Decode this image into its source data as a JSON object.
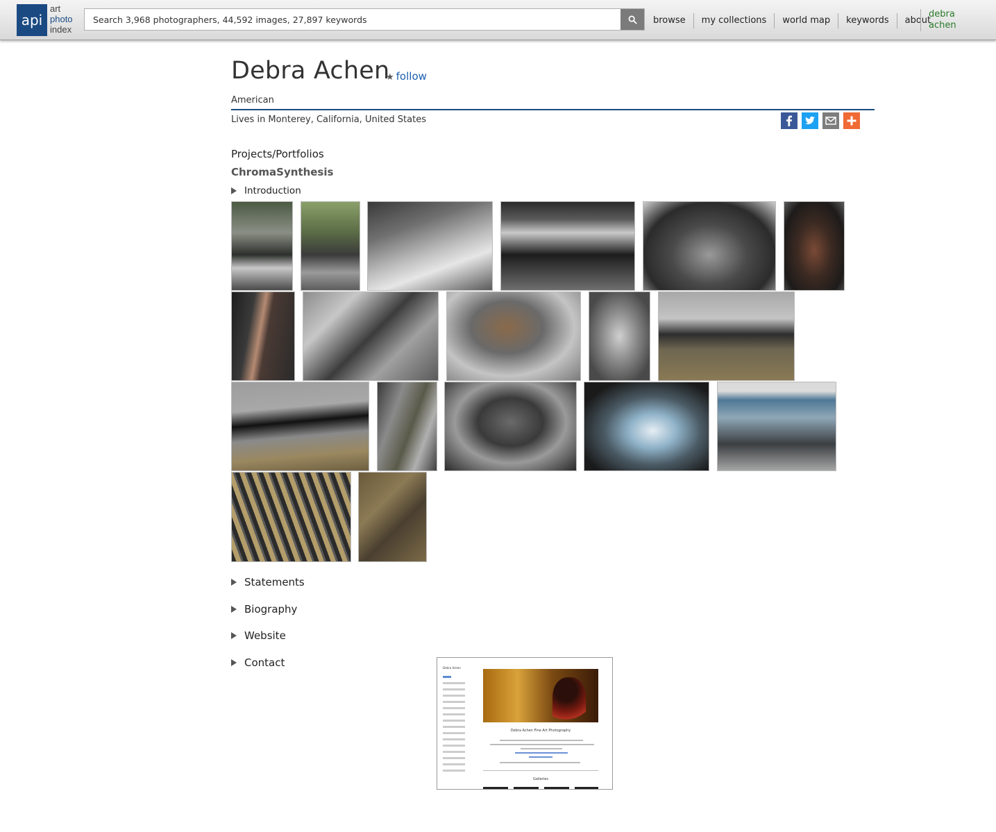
{
  "header": {
    "logo_abbr": "api",
    "logo_words": [
      "art",
      "photo",
      "index"
    ],
    "search_placeholder": "Search 3,968 photographers, 44,592 images, 27,897 keywords",
    "nav": [
      "browse",
      "my collections",
      "world map",
      "keywords",
      "about"
    ],
    "user": [
      "debra",
      "achen"
    ]
  },
  "profile": {
    "name": "Debra Achen",
    "follow_star": "★",
    "follow_label": "follow",
    "nationality": "American",
    "location": "Lives in Monterey, California, United States"
  },
  "share": [
    "facebook",
    "twitter",
    "email",
    "more"
  ],
  "sections": {
    "projects_heading": "Projects/Portfolios",
    "project_name": "ChromaSynthesis",
    "introduction": "Introduction",
    "statements": "Statements",
    "biography": "Biography",
    "website": "Website",
    "contact": "Contact"
  },
  "website_preview": {
    "site_name": "Debra Achen",
    "headline": "Debra Achen Fine Art Photography",
    "galleries": "Galleries"
  },
  "colors": {
    "brand_blue": "#1b4a83",
    "link_blue": "#1b5fb0",
    "user_green": "#2a7a2a",
    "facebook": "#3b5998",
    "twitter": "#1da1f2",
    "email": "#7d7d7d",
    "more": "#f06a35"
  }
}
